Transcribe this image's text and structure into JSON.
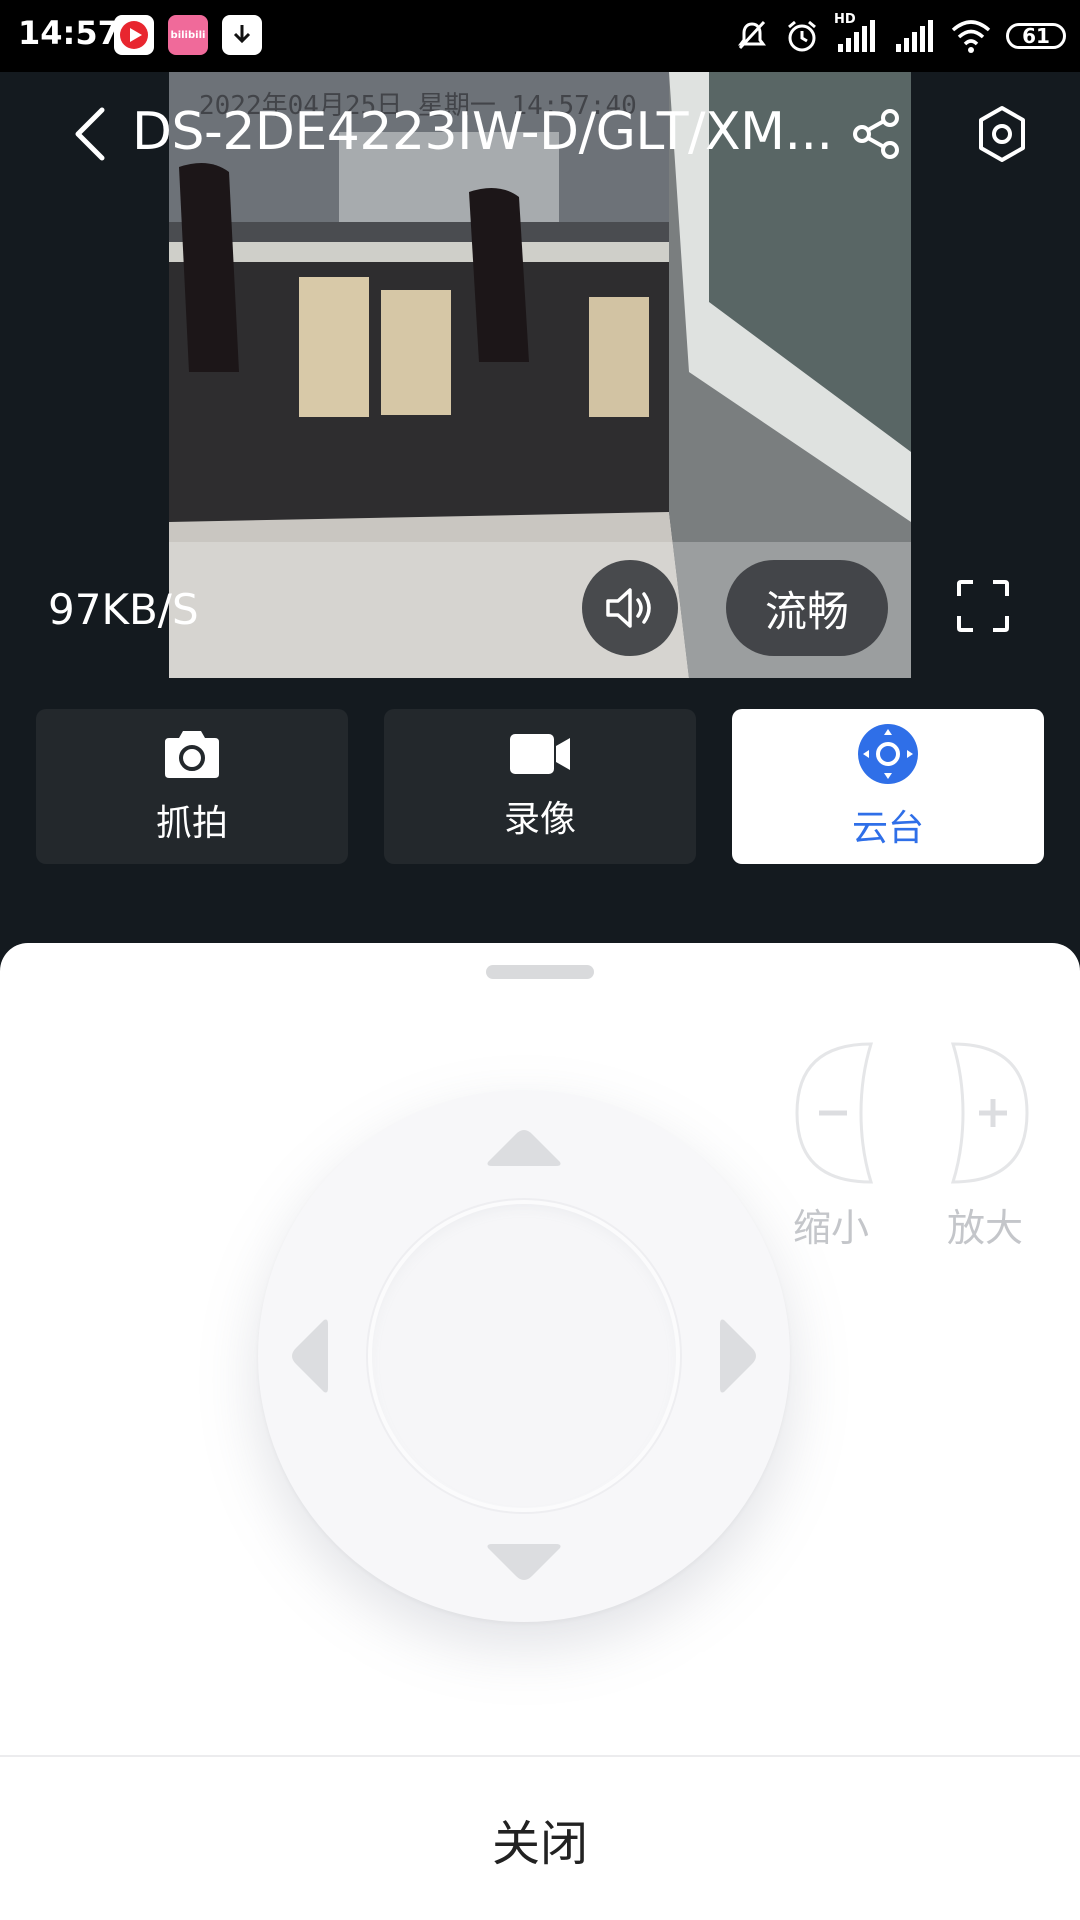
{
  "status_bar": {
    "time": "14:57",
    "battery": "61",
    "network_label": "HD",
    "icons": [
      "mute-icon",
      "alarm-icon",
      "signal-icon",
      "signal-icon",
      "wifi-icon"
    ],
    "notification_apps": [
      "video-app-icon",
      "bilibili-app-icon",
      "download-icon"
    ],
    "bilibili_text": "bilibili"
  },
  "video": {
    "osd_timestamp": "2022年04月25日 星期一 14:57:40",
    "bitrate": "97KB/S",
    "quality": "流畅"
  },
  "header": {
    "title": "DS-2DE4223IW-D/GLT/XM..."
  },
  "actions": [
    {
      "label": "抓拍",
      "icon": "camera-icon",
      "active": false
    },
    {
      "label": "录像",
      "icon": "video-camera-icon",
      "active": false
    },
    {
      "label": "云台",
      "icon": "ptz-icon",
      "active": true
    }
  ],
  "ptz_panel": {
    "zoom_out_label": "缩小",
    "zoom_in_label": "放大",
    "close_label": "关闭"
  },
  "colors": {
    "accent": "#2f6fe8",
    "dark_bg": "#141a1f",
    "button_bg": "#23282c"
  }
}
